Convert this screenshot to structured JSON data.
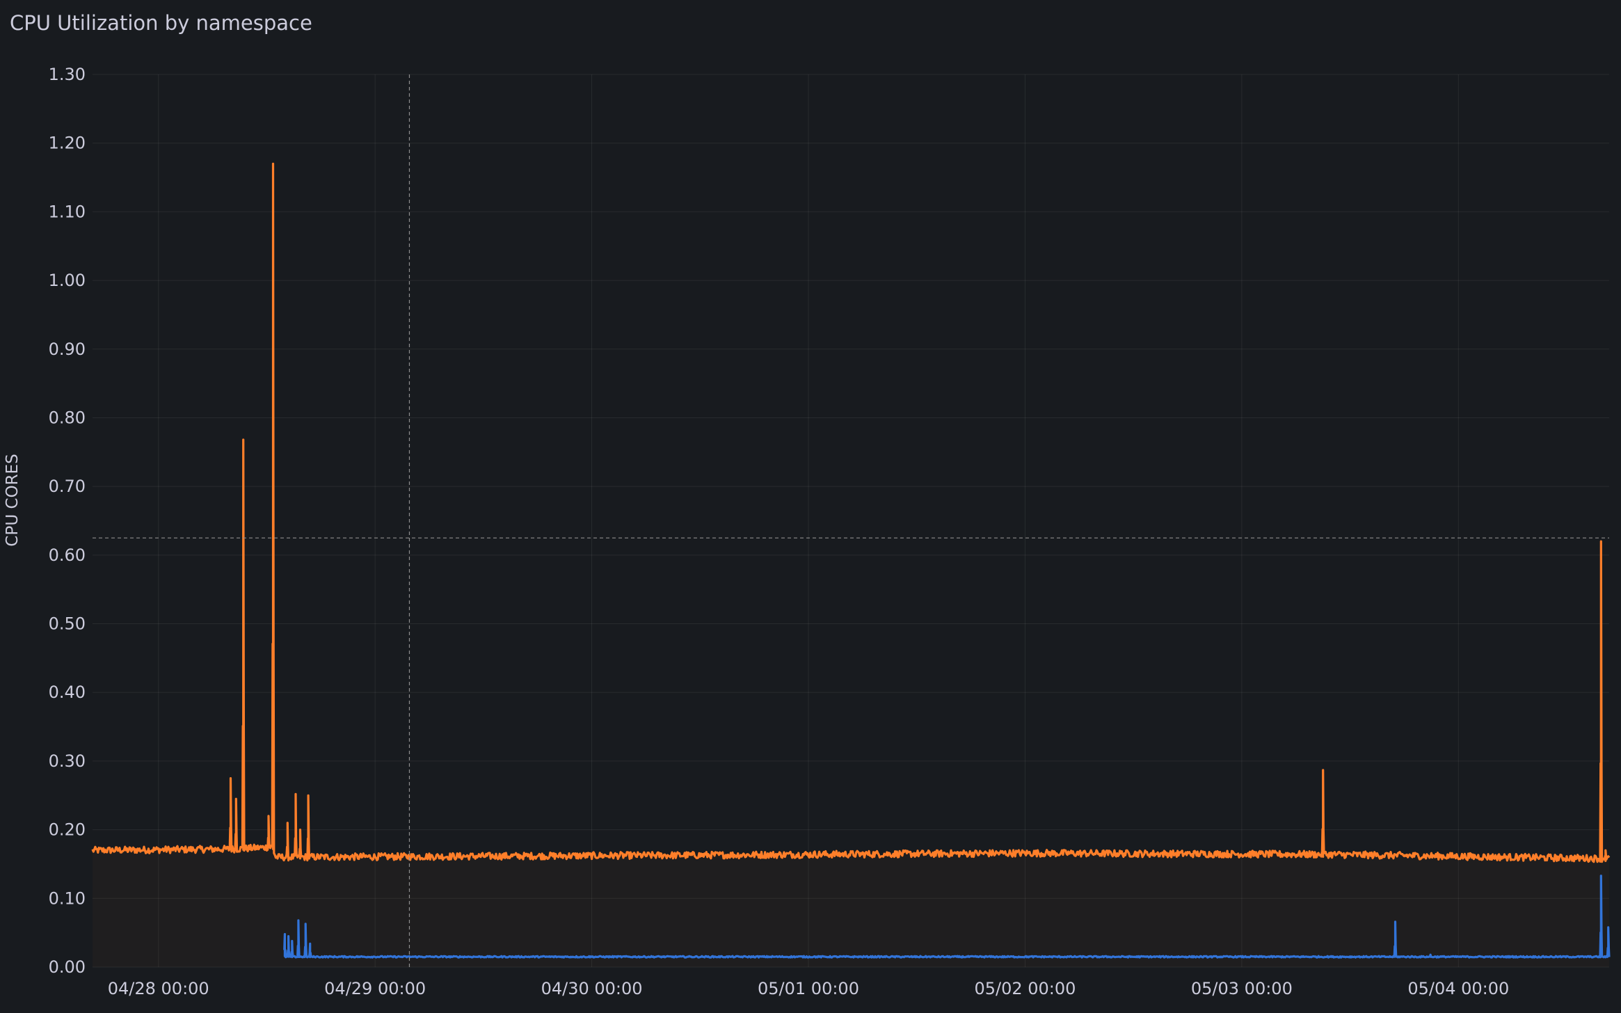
{
  "panel": {
    "title": "CPU Utilization by namespace"
  },
  "chart_data": {
    "type": "line",
    "title": "CPU Utilization by namespace",
    "ylabel": "CPU CORES",
    "xlabel": "",
    "ylim": [
      0,
      1.3
    ],
    "y_ticks": [
      "0.00",
      "0.10",
      "0.20",
      "0.30",
      "0.40",
      "0.50",
      "0.60",
      "0.70",
      "0.80",
      "0.90",
      "1.00",
      "1.10",
      "1.20",
      "1.30"
    ],
    "x_ticks": [
      {
        "label": "04/28 00:00",
        "t": 0
      },
      {
        "label": "04/29 00:00",
        "t": 24
      },
      {
        "label": "04/30 00:00",
        "t": 48
      },
      {
        "label": "05/01 00:00",
        "t": 72
      },
      {
        "label": "05/02 00:00",
        "t": 96
      },
      {
        "label": "05/03 00:00",
        "t": 120
      },
      {
        "label": "05/04 00:00",
        "t": 144
      }
    ],
    "x_range_hours_from_0428": [
      -7.3,
      160.7
    ],
    "grid": true,
    "legend": "none",
    "crosshair": {
      "x_hours_from_0428": 27.8,
      "y": 0.625
    },
    "series": [
      {
        "color": "#ff7f2a",
        "fill": "#ff7f2a",
        "baseline": [
          [
            -7.3,
            0.17
          ],
          [
            8.8,
            0.172
          ],
          [
            12.6,
            0.175
          ],
          [
            13.0,
            0.16
          ],
          [
            60,
            0.163
          ],
          [
            96,
            0.166
          ],
          [
            130,
            0.164
          ],
          [
            150,
            0.16
          ],
          [
            160.7,
            0.158
          ]
        ],
        "noise": 0.005,
        "spikes": [
          [
            8.0,
            0.275
          ],
          [
            8.6,
            0.245
          ],
          [
            9.4,
            0.768
          ],
          [
            12.2,
            0.22
          ],
          [
            12.7,
            1.17
          ],
          [
            14.3,
            0.21
          ],
          [
            15.2,
            0.252
          ],
          [
            15.7,
            0.2
          ],
          [
            16.6,
            0.25
          ],
          [
            129.0,
            0.287
          ],
          [
            159.8,
            0.62
          ],
          [
            160.3,
            0.17
          ]
        ]
      },
      {
        "color": "#3274d9",
        "baseline": [
          [
            14.0,
            0.015
          ],
          [
            160.7,
            0.015
          ]
        ],
        "noise": 0.001,
        "spikes": [
          [
            14.0,
            0.048
          ],
          [
            14.4,
            0.045
          ],
          [
            14.8,
            0.038
          ],
          [
            15.5,
            0.068
          ],
          [
            16.3,
            0.063
          ],
          [
            16.8,
            0.034
          ],
          [
            137.0,
            0.066
          ],
          [
            140.9,
            0.018
          ],
          [
            159.8,
            0.133
          ],
          [
            160.6,
            0.058
          ]
        ]
      }
    ]
  }
}
